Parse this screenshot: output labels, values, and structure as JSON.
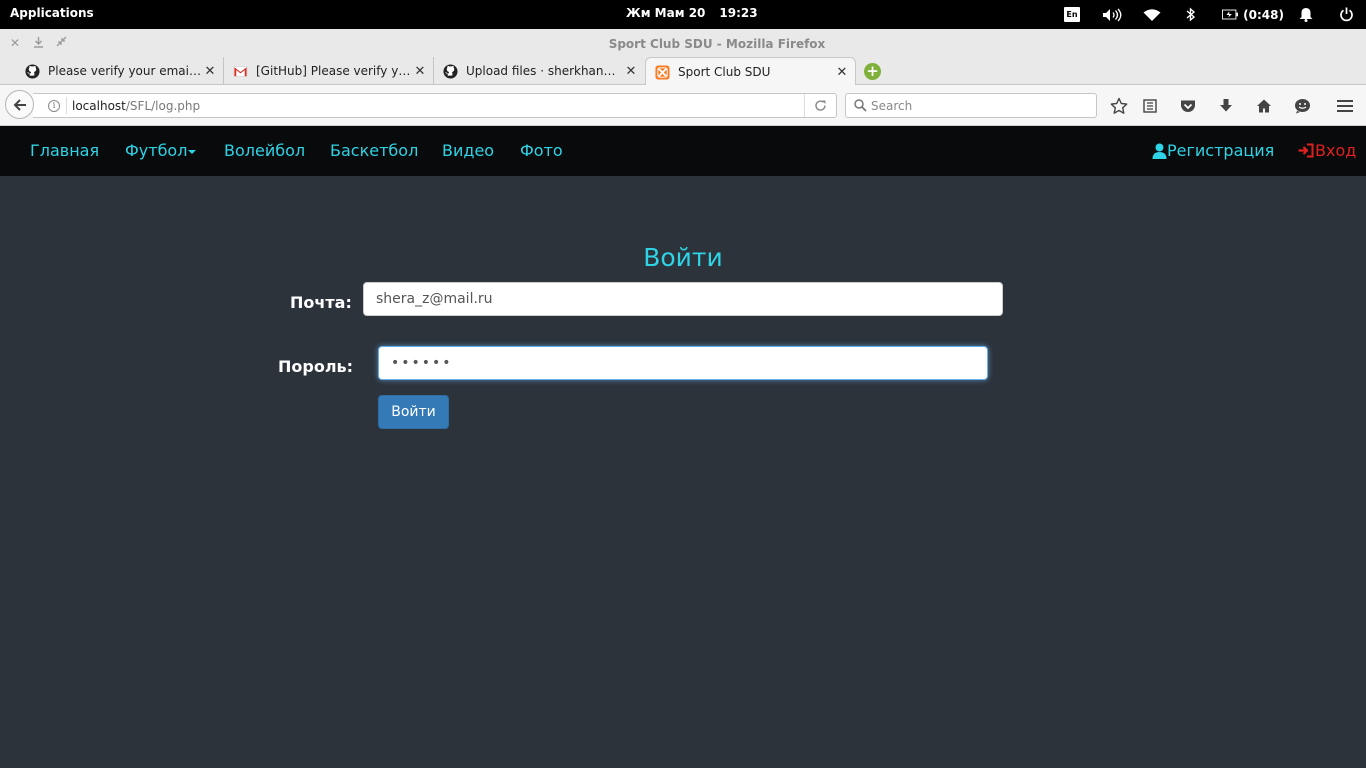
{
  "system_panel": {
    "applications": "Applications",
    "date": "Жм Мам 20",
    "time": "19:23",
    "keyboard_layout": "En",
    "battery": "(0:48)"
  },
  "window": {
    "title": "Sport Club SDU - Mozilla Firefox"
  },
  "tabs": [
    {
      "label": "Please verify your email ad...",
      "icon": "github-icon"
    },
    {
      "label": "[GitHub] Please verify your...",
      "icon": "gmail-icon"
    },
    {
      "label": "Upload files · sherkhancrs/...",
      "icon": "github-icon"
    },
    {
      "label": "Sport Club SDU",
      "icon": "xampp-icon",
      "active": true
    }
  ],
  "address_bar": {
    "url_host": "localhost",
    "url_path": "/SFL/log.php"
  },
  "search_bar": {
    "placeholder": "Search"
  },
  "site_nav": {
    "home": "Главная",
    "football": "Футбол",
    "volleyball": "Волейбол",
    "basketball": "Баскетбол",
    "video": "Видео",
    "photo": "Фото",
    "register": "Регистрация",
    "login": "Вход"
  },
  "login_form": {
    "title": "Войти",
    "email_label": "Почта:",
    "email_value": "shera_z@mail.ru",
    "password_label": "Пороль:",
    "password_value": "••••••",
    "submit_label": "Войти"
  },
  "colors": {
    "accent": "#2fd3e6",
    "login_red": "#e02020",
    "page_bg": "#2c333b",
    "nav_bg": "#090a0b",
    "button_blue": "#337ab7"
  }
}
